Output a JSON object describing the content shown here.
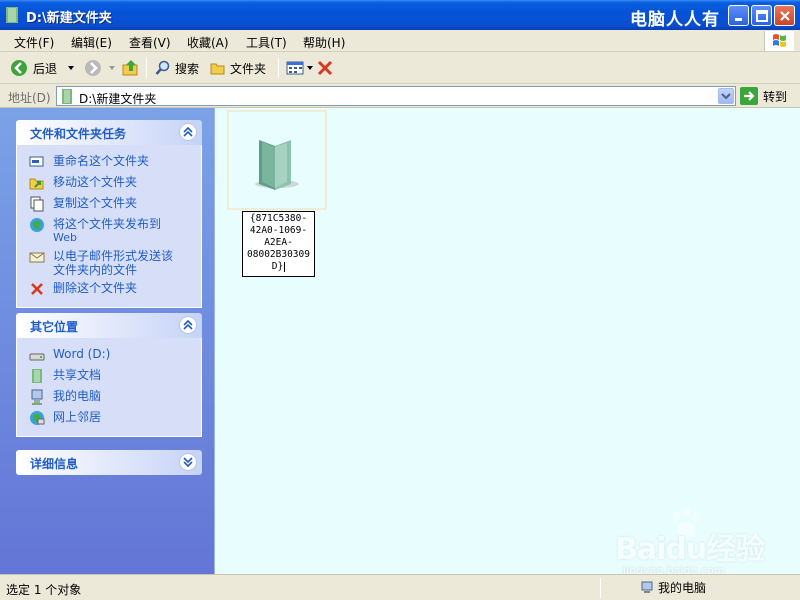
{
  "window": {
    "title": "D:\\新建文件夹",
    "brand_text": "电脑人人有"
  },
  "menu": [
    "文件(F)",
    "编辑(E)",
    "查看(V)",
    "收藏(A)",
    "工具(T)",
    "帮助(H)"
  ],
  "toolbar": {
    "back_label": "后退",
    "search_label": "搜索",
    "folders_label": "文件夹"
  },
  "address": {
    "label": "地址(D)",
    "value": "D:\\新建文件夹",
    "go_label": "转到"
  },
  "panels": {
    "tasks": {
      "title": "文件和文件夹任务",
      "items": [
        {
          "label": "重命名这个文件夹",
          "icon": "rename-icon"
        },
        {
          "label": "移动这个文件夹",
          "icon": "move-icon"
        },
        {
          "label": "复制这个文件夹",
          "icon": "copy-icon"
        },
        {
          "label": "将这个文件夹发布到",
          "label2": "Web",
          "icon": "publish-web-icon"
        },
        {
          "label": "以电子邮件形式发送该",
          "label2": "文件夹内的文件",
          "icon": "email-icon"
        },
        {
          "label": "删除这个文件夹",
          "icon": "delete-icon"
        }
      ]
    },
    "other_places": {
      "title": "其它位置",
      "items": [
        {
          "label": "Word (D:)",
          "icon": "drive-icon"
        },
        {
          "label": "共享文档",
          "icon": "shared-docs-icon"
        },
        {
          "label": "我的电脑",
          "icon": "my-computer-icon"
        },
        {
          "label": "网上邻居",
          "icon": "network-icon"
        }
      ]
    },
    "details": {
      "title": "详细信息"
    }
  },
  "content": {
    "item": {
      "name_lines": [
        "{871C5380-",
        "42A0-1069-",
        "A2EA-",
        "08002B30309",
        "D}"
      ]
    }
  },
  "status": {
    "left": "选定 1 个对象",
    "right": "我的电脑"
  },
  "watermark": {
    "text": "Baidu经验",
    "sub": "jingyan.baidu.com"
  },
  "colors": {
    "title_bar": "#0553d6",
    "panel_link": "#215dc6",
    "content_bg": "#e8fdfd"
  }
}
